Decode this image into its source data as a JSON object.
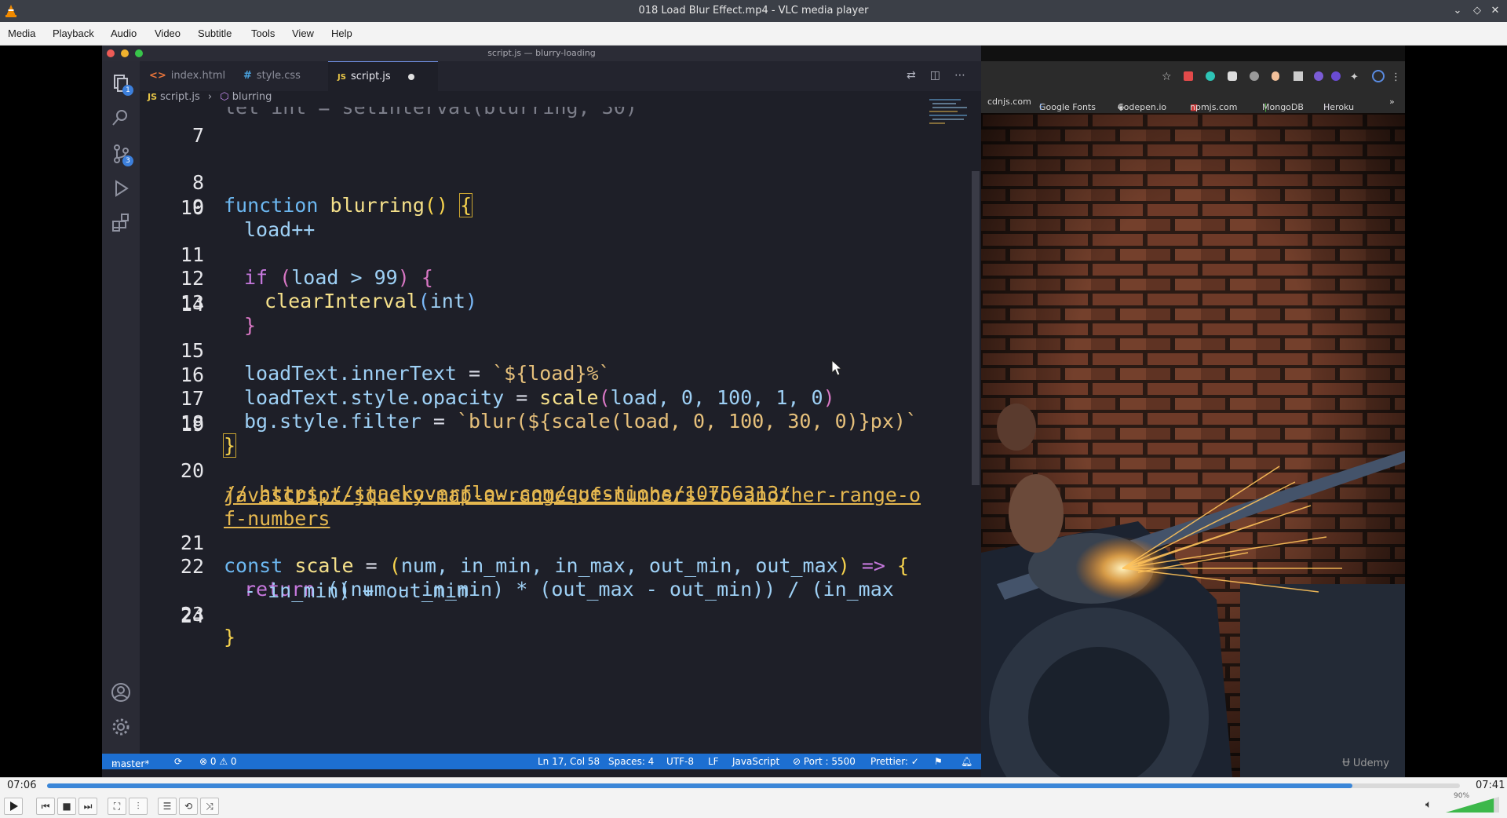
{
  "window": {
    "title": "018 Load Blur Effect.mp4 - VLC media player"
  },
  "menu": [
    "Media",
    "Playback",
    "Audio",
    "Video",
    "Subtitle",
    "Tools",
    "View",
    "Help"
  ],
  "vscode": {
    "window_title": "script.js — blurry-loading",
    "tabs": [
      {
        "icon": "<>",
        "label": "index.html"
      },
      {
        "icon": "#",
        "label": "style.css"
      },
      {
        "icon": "JS",
        "label": "script.js"
      }
    ],
    "breadcrumb": {
      "file": "script.js",
      "symbol": "blurring"
    },
    "activity_badges": {
      "explorer": "1",
      "source_control": "3"
    },
    "line_numbers": [
      "7",
      "8",
      "9",
      "10",
      "11",
      "12",
      "13",
      "14",
      "15",
      "16",
      "17",
      "18",
      "19",
      "20",
      "21",
      "22",
      "23",
      "24"
    ],
    "code": {
      "l8_kw": "function",
      "l8_fn": "blurring",
      "l9": "load++",
      "l11_kw": "if",
      "l11_cond": "load > 99",
      "l12_fn": "clearInterval",
      "l12_arg": "int",
      "l15_a": "loadText.innerText",
      "l15_b": "${load}%",
      "l16_a": "loadText.style.opacity",
      "l16_fn": "scale",
      "l16_args": "load, 0, 100, 1, 0",
      "l17_a": "bg.style.filter",
      "l17_b": "blur(${scale(load, 0, 100, 30, 0)}px)",
      "l20_prefix": "// ",
      "l20_url": "https://stackoverflow.com/questions/10756313/",
      "l20_wrap1": "javascript-jquery-map-a-range-of-numbers-to-another-range-o",
      "l20_wrap2": "f-numbers",
      "l21_kw": "const",
      "l21_fn": "scale",
      "l21_params": "num, in_min, in_max, out_min, out_max",
      "l22_kw": "return",
      "l22_expr": "((num - in_min) * (out_max - out_min)) / (in_max",
      "l22_wrap": "- in_min) + out_min"
    },
    "status": {
      "branch": "master*",
      "problems": "⊗ 0 ⚠ 0",
      "position": "Ln 17, Col 58",
      "spaces": "Spaces: 4",
      "encoding": "UTF-8",
      "eol": "LF",
      "language": "JavaScript",
      "port": "⊘ Port : 5500",
      "prettier": "Prettier: ✓"
    }
  },
  "browser": {
    "bookmarks": [
      "cdnjs.com",
      "Google Fonts",
      "Codepen.io",
      "npmjs.com",
      "MongoDB",
      "Heroku"
    ],
    "watermark": "Udemy"
  },
  "player": {
    "elapsed": "07:06",
    "total": "07:41",
    "progress_fraction": 0.924,
    "volume_label": "90%",
    "volume_fraction": 0.9
  }
}
